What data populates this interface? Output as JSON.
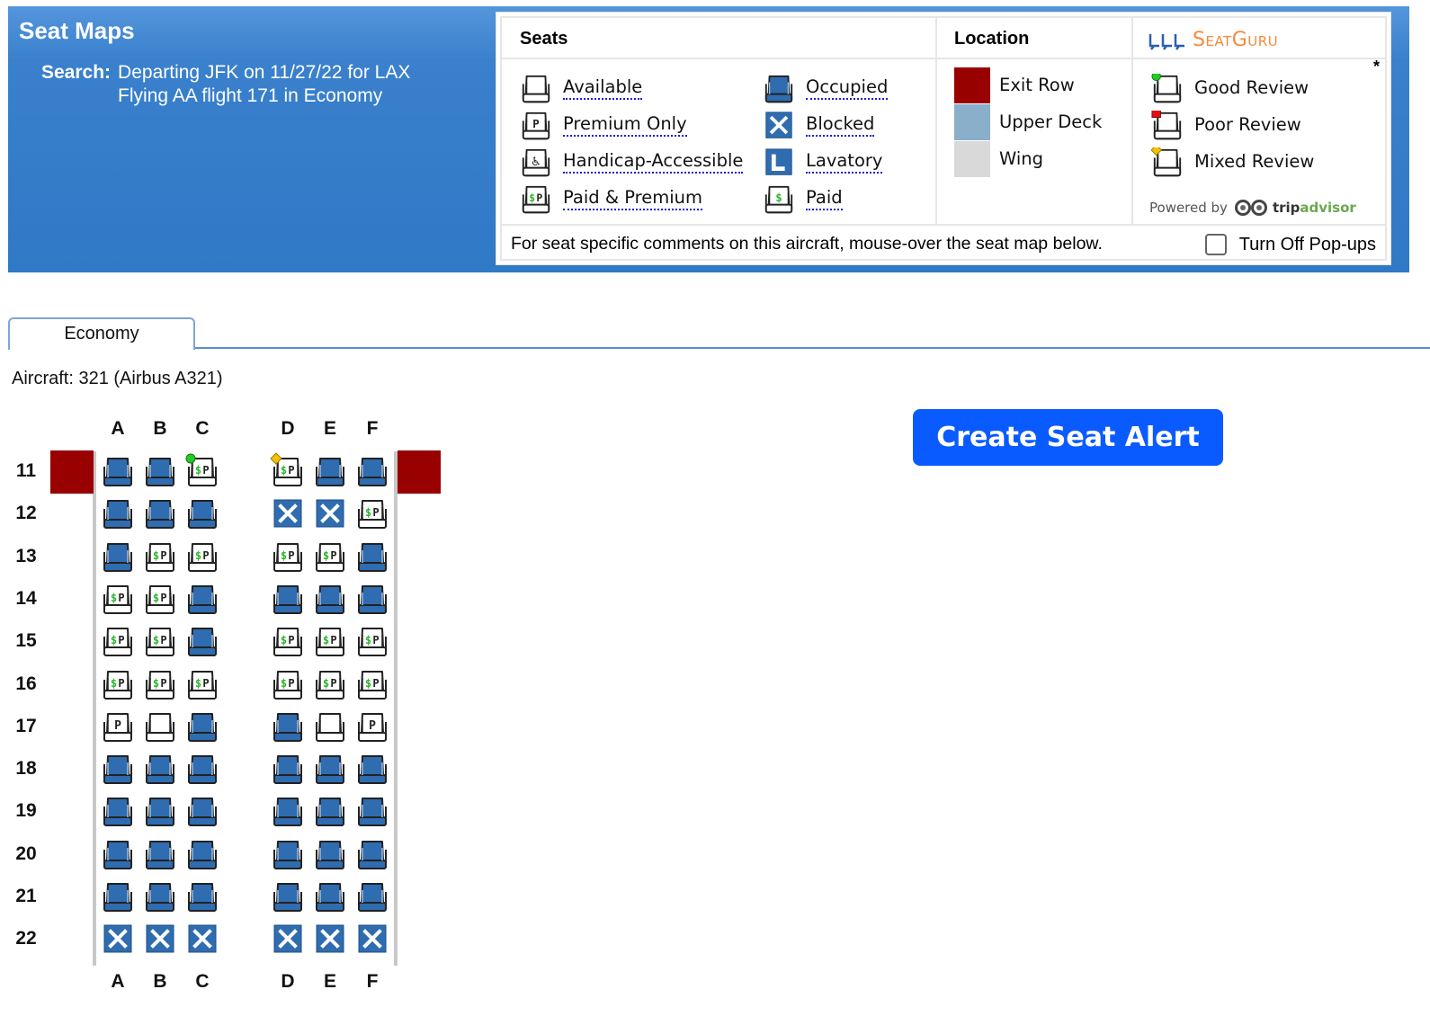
{
  "header": {
    "title": "Seat Maps",
    "search_label": "Search:",
    "search_line1": "Departing JFK on 11/27/22 for LAX",
    "search_line2": "Flying AA flight 171 in Economy"
  },
  "legend": {
    "seats_heading": "Seats",
    "location_heading": "Location",
    "seat_types_left": [
      {
        "type": "available",
        "label": "Available"
      },
      {
        "type": "premium",
        "label": "Premium Only"
      },
      {
        "type": "handicap",
        "label": "Handicap-Accessible"
      },
      {
        "type": "paid_premium",
        "label": "Paid & Premium"
      }
    ],
    "seat_types_right": [
      {
        "type": "occupied",
        "label": "Occupied"
      },
      {
        "type": "blocked",
        "label": "Blocked"
      },
      {
        "type": "lavatory",
        "label": "Lavatory"
      },
      {
        "type": "paid",
        "label": "Paid"
      }
    ],
    "locations": [
      {
        "label": "Exit Row",
        "color": "#990000"
      },
      {
        "label": "Upper Deck",
        "color": "#8aafcb"
      },
      {
        "label": "Wing",
        "color": "#d9d9d9"
      }
    ],
    "reviews": [
      {
        "label": "Good Review",
        "marker": "green-circle",
        "color": "#22cc22"
      },
      {
        "label": "Poor Review",
        "marker": "red-square",
        "color": "#e01010"
      },
      {
        "label": "Mixed Review",
        "marker": "yellow-diamond",
        "color": "#f2c200"
      }
    ],
    "brand_name": "SeatGuru",
    "asterisk": "*",
    "powered_by": "Powered by",
    "powered_trip": "trip",
    "powered_advisor": "advisor",
    "footer_note": "For seat specific comments on this aircraft, mouse-over the seat map below.",
    "popup_toggle_label": "Turn Off Pop-ups",
    "popup_toggle_checked": false
  },
  "tabs": [
    {
      "label": "Economy",
      "active": true
    }
  ],
  "aircraft": "Aircraft: 321 (Airbus A321)",
  "cta_label": "Create Seat Alert",
  "colors": {
    "header_blue": "#3079c6",
    "occupied_blue": "#2f6cb0",
    "exit_red": "#990000",
    "cta_blue": "#0a5bff",
    "seatguru_orange": "#f58a3c"
  },
  "seatmap": {
    "columns_left": [
      "A",
      "B",
      "C"
    ],
    "columns_right": [
      "D",
      "E",
      "F"
    ],
    "exit_rows": [
      11
    ],
    "rows": [
      {
        "row": "11",
        "seats": [
          {
            "col": "A",
            "type": "occupied"
          },
          {
            "col": "B",
            "type": "occupied"
          },
          {
            "col": "C",
            "type": "paid_premium",
            "review": "good"
          },
          {
            "col": "D",
            "type": "paid_premium",
            "review": "mixed"
          },
          {
            "col": "E",
            "type": "occupied"
          },
          {
            "col": "F",
            "type": "occupied"
          }
        ]
      },
      {
        "row": "12",
        "seats": [
          {
            "col": "A",
            "type": "occupied"
          },
          {
            "col": "B",
            "type": "occupied"
          },
          {
            "col": "C",
            "type": "occupied"
          },
          {
            "col": "D",
            "type": "blocked"
          },
          {
            "col": "E",
            "type": "blocked"
          },
          {
            "col": "F",
            "type": "paid_premium"
          }
        ]
      },
      {
        "row": "13",
        "seats": [
          {
            "col": "A",
            "type": "occupied"
          },
          {
            "col": "B",
            "type": "paid_premium"
          },
          {
            "col": "C",
            "type": "paid_premium"
          },
          {
            "col": "D",
            "type": "paid_premium"
          },
          {
            "col": "E",
            "type": "paid_premium"
          },
          {
            "col": "F",
            "type": "occupied"
          }
        ]
      },
      {
        "row": "14",
        "seats": [
          {
            "col": "A",
            "type": "paid_premium"
          },
          {
            "col": "B",
            "type": "paid_premium"
          },
          {
            "col": "C",
            "type": "occupied"
          },
          {
            "col": "D",
            "type": "occupied"
          },
          {
            "col": "E",
            "type": "occupied"
          },
          {
            "col": "F",
            "type": "occupied"
          }
        ]
      },
      {
        "row": "15",
        "seats": [
          {
            "col": "A",
            "type": "paid_premium"
          },
          {
            "col": "B",
            "type": "paid_premium"
          },
          {
            "col": "C",
            "type": "occupied"
          },
          {
            "col": "D",
            "type": "paid_premium"
          },
          {
            "col": "E",
            "type": "paid_premium"
          },
          {
            "col": "F",
            "type": "paid_premium"
          }
        ]
      },
      {
        "row": "16",
        "seats": [
          {
            "col": "A",
            "type": "paid_premium"
          },
          {
            "col": "B",
            "type": "paid_premium"
          },
          {
            "col": "C",
            "type": "paid_premium"
          },
          {
            "col": "D",
            "type": "paid_premium"
          },
          {
            "col": "E",
            "type": "paid_premium"
          },
          {
            "col": "F",
            "type": "paid_premium"
          }
        ]
      },
      {
        "row": "17",
        "seats": [
          {
            "col": "A",
            "type": "premium"
          },
          {
            "col": "B",
            "type": "available"
          },
          {
            "col": "C",
            "type": "occupied"
          },
          {
            "col": "D",
            "type": "occupied"
          },
          {
            "col": "E",
            "type": "available"
          },
          {
            "col": "F",
            "type": "premium"
          }
        ]
      },
      {
        "row": "18",
        "seats": [
          {
            "col": "A",
            "type": "occupied"
          },
          {
            "col": "B",
            "type": "occupied"
          },
          {
            "col": "C",
            "type": "occupied"
          },
          {
            "col": "D",
            "type": "occupied"
          },
          {
            "col": "E",
            "type": "occupied"
          },
          {
            "col": "F",
            "type": "occupied"
          }
        ]
      },
      {
        "row": "19",
        "seats": [
          {
            "col": "A",
            "type": "occupied"
          },
          {
            "col": "B",
            "type": "occupied"
          },
          {
            "col": "C",
            "type": "occupied"
          },
          {
            "col": "D",
            "type": "occupied"
          },
          {
            "col": "E",
            "type": "occupied"
          },
          {
            "col": "F",
            "type": "occupied"
          }
        ]
      },
      {
        "row": "20",
        "seats": [
          {
            "col": "A",
            "type": "occupied"
          },
          {
            "col": "B",
            "type": "occupied"
          },
          {
            "col": "C",
            "type": "occupied"
          },
          {
            "col": "D",
            "type": "occupied"
          },
          {
            "col": "E",
            "type": "occupied"
          },
          {
            "col": "F",
            "type": "occupied"
          }
        ]
      },
      {
        "row": "21",
        "seats": [
          {
            "col": "A",
            "type": "occupied"
          },
          {
            "col": "B",
            "type": "occupied"
          },
          {
            "col": "C",
            "type": "occupied"
          },
          {
            "col": "D",
            "type": "occupied"
          },
          {
            "col": "E",
            "type": "occupied"
          },
          {
            "col": "F",
            "type": "occupied"
          }
        ]
      },
      {
        "row": "22",
        "seats": [
          {
            "col": "A",
            "type": "blocked"
          },
          {
            "col": "B",
            "type": "blocked"
          },
          {
            "col": "C",
            "type": "blocked"
          },
          {
            "col": "D",
            "type": "blocked"
          },
          {
            "col": "E",
            "type": "blocked"
          },
          {
            "col": "F",
            "type": "blocked"
          }
        ]
      }
    ]
  }
}
